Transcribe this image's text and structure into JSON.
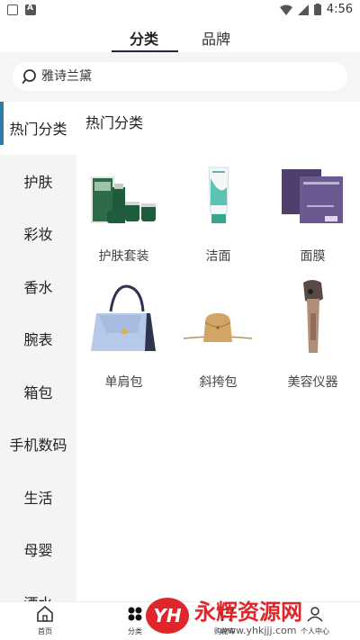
{
  "status_bar": {
    "time": "4:56"
  },
  "top_tabs": [
    {
      "label": "分类",
      "active": true
    },
    {
      "label": "品牌",
      "active": false
    }
  ],
  "search": {
    "placeholder": "雅诗兰黛",
    "icon": "search-icon"
  },
  "sidebar": {
    "items": [
      {
        "label": "热门分类",
        "active": true
      },
      {
        "label": "护肤"
      },
      {
        "label": "彩妆"
      },
      {
        "label": "香水"
      },
      {
        "label": "腕表"
      },
      {
        "label": "箱包"
      },
      {
        "label": "手机数码"
      },
      {
        "label": "生活"
      },
      {
        "label": "母婴"
      },
      {
        "label": "酒水"
      }
    ]
  },
  "content": {
    "section_title": "热门分类",
    "items": [
      {
        "label": "护肤套装",
        "icon": "skincare-set-image"
      },
      {
        "label": "洁面",
        "icon": "cleanser-tube-image"
      },
      {
        "label": "面膜",
        "icon": "face-mask-box-image"
      },
      {
        "label": "单肩包",
        "icon": "shoulder-bag-image"
      },
      {
        "label": "斜挎包",
        "icon": "crossbody-bag-image"
      },
      {
        "label": "美容仪器",
        "icon": "beauty-device-image"
      }
    ]
  },
  "bottom_nav": [
    {
      "label": "首页",
      "icon": "home-icon"
    },
    {
      "label": "分类",
      "icon": "category-icon",
      "active": true
    },
    {
      "label": "购物车",
      "icon": "cart-icon"
    },
    {
      "label": "个人中心",
      "icon": "user-icon"
    }
  ],
  "watermark": {
    "text": "永辉资源网",
    "logo": "YH",
    "url": "www.yhkjjj.com"
  },
  "colors": {
    "accent": "#2d7ea4",
    "tab_underline": "#1e2a40",
    "watermark_red": "#e0262b"
  }
}
